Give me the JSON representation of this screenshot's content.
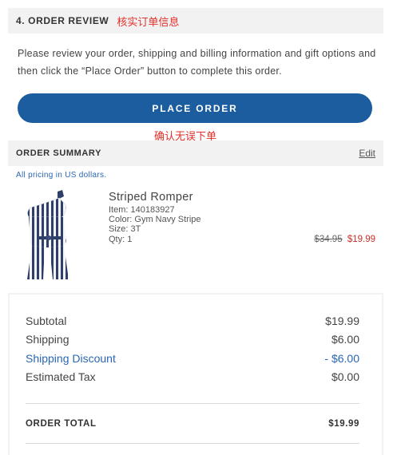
{
  "review": {
    "title": "4. ORDER REVIEW",
    "annotation": "核实订单信息",
    "instructions": "Please review your order, shipping and billing information and gift options and then click the “Place Order” button to complete this order."
  },
  "place_order": {
    "label": "PLACE ORDER",
    "annotation": "确认无误下单"
  },
  "summary": {
    "title": "ORDER SUMMARY",
    "edit_label": "Edit",
    "pricing_note": "All pricing in US dollars.",
    "product": {
      "name": "Striped Romper",
      "item": "Item: 140183927",
      "color": "Color: Gym Navy Stripe",
      "size": "Size: 3T",
      "qty": "Qty: 1",
      "price_original": "$34.95",
      "price_sale": "$19.99"
    }
  },
  "totals": {
    "subtotal_label": "Subtotal",
    "subtotal_value": "$19.99",
    "shipping_label": "Shipping",
    "shipping_value": "$6.00",
    "discount_label": "Shipping Discount",
    "discount_value": "- $6.00",
    "tax_label": "Estimated Tax",
    "tax_value": "$0.00",
    "order_total_label": "ORDER TOTAL",
    "order_total_value": "$19.99"
  },
  "colors": {
    "accent": "#1b5d9e",
    "annotation": "#e0302a",
    "link": "#2a66b3",
    "sale": "#c9302c"
  }
}
